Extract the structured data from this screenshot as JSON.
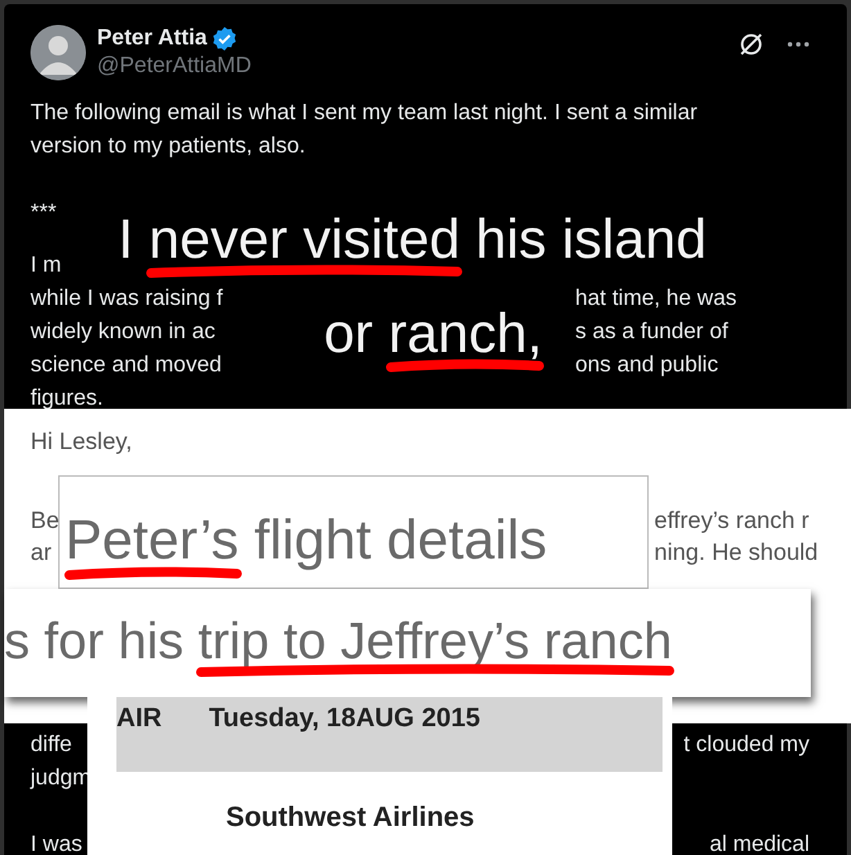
{
  "tweet": {
    "author": {
      "name": "Peter Attia",
      "verified": true,
      "handle": "@PeterAttiaMD"
    },
    "paragraphs": [
      "The following email is what I sent my team last night. I sent a similar version to my patients, also.",
      "***"
    ],
    "upper_fragments": [
      {
        "left": "I m"
      },
      {
        "left": "while I was raising f",
        "right": "hat time, he was"
      },
      {
        "left": "widely known in ac",
        "right": "s as a funder of"
      },
      {
        "left": "science and moved",
        "right": "ons and public"
      },
      {
        "left": "figures."
      }
    ],
    "lower_fragments": [
      {
        "left": "diffe",
        "right": "t clouded my"
      },
      {
        "left": "judgm"
      },
      {
        "left": "I was",
        "right": "al medical"
      }
    ]
  },
  "overlays": [
    {
      "kind": "caption",
      "lines": [
        [
          {
            "text": "I ",
            "underlined": false
          },
          {
            "text": "never visited",
            "underlined": true
          },
          {
            "text": " his island",
            "underlined": false
          }
        ],
        [
          {
            "text": "or ",
            "underlined": false
          },
          {
            "text": "ranch,",
            "underlined": true
          }
        ]
      ]
    },
    {
      "kind": "email",
      "greeting": "Hi Lesley,",
      "fragments": [
        {
          "left": "Be",
          "right": "effrey’s ranch r"
        },
        {
          "left": "ar",
          "right": "ning. He should"
        }
      ]
    },
    {
      "kind": "clip",
      "lines": [
        [
          {
            "text": "Peter’s",
            "underlined": true
          },
          {
            "text": " flight details",
            "underlined": false
          }
        ]
      ]
    },
    {
      "kind": "clip_wide",
      "lines": [
        [
          {
            "text": "s for his ",
            "underlined": false
          },
          {
            "text": "trip to Jeffrey’s ranch",
            "underlined": true
          }
        ]
      ]
    },
    {
      "kind": "flight",
      "mode": "AIR",
      "date": "Tuesday, 18AUG 2015",
      "airline": "Southwest Airlines"
    }
  ]
}
